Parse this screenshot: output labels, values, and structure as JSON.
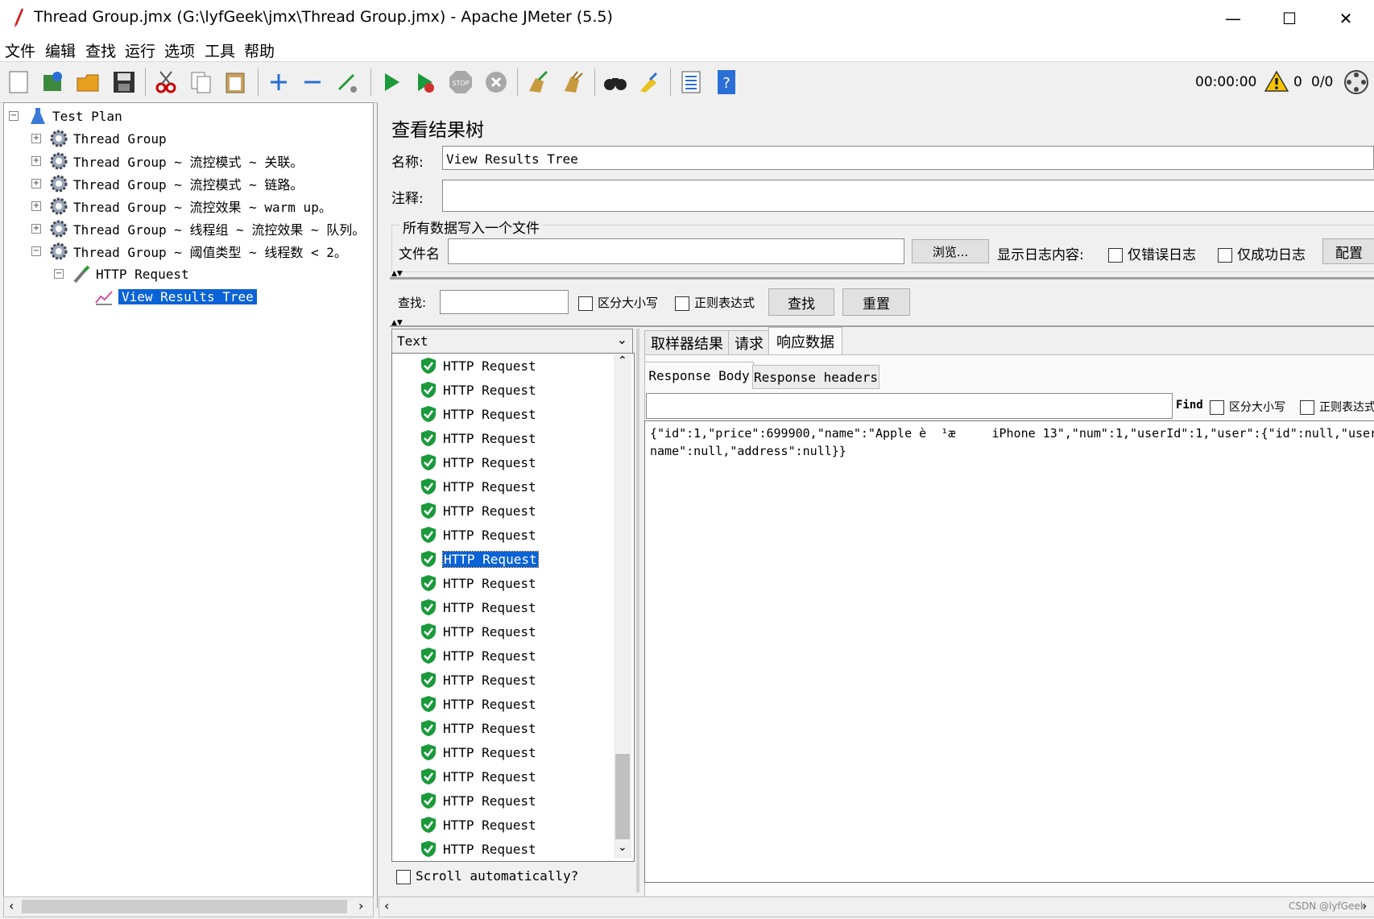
{
  "window": {
    "title": "Thread Group.jmx (G:\\lyfGeek\\jmx\\Thread Group.jmx) - Apache JMeter (5.5)",
    "minimize": "—",
    "maximize": "☐",
    "close": "✕"
  },
  "menu": [
    "文件",
    "编辑",
    "查找",
    "运行",
    "选项",
    "工具",
    "帮助"
  ],
  "toolbar": {
    "elapsed_time": "00:00:00",
    "warning_count": "0",
    "thread_count": "0/0",
    "colors": {
      "start": "#1a9a3a",
      "stop": "#9a9a9a",
      "help": "#2a6fd6"
    }
  },
  "tree": {
    "root": "Test Plan",
    "groups": [
      "Thread Group",
      "Thread Group ~ 流控模式 ~ 关联。",
      "Thread Group ~ 流控模式 ~ 链路。",
      "Thread Group ~ 流控效果 ~ warm up。",
      "Thread Group ~ 线程组 ~ 流控效果 ~ 队列。",
      "Thread Group ~ 阈值类型 ~ 线程数 < 2。"
    ],
    "sampler": "HTTP Request",
    "listener": "View Results Tree"
  },
  "panel": {
    "heading": "查看结果树",
    "name_label": "名称:",
    "name_value": "View Results Tree",
    "comment_label": "注释:",
    "comment_value": "",
    "file_section": "所有数据写入一个文件",
    "filename_label": "文件名",
    "filename_value": "",
    "browse": "浏览...",
    "log_label": "显示日志内容:",
    "errors_only": "仅错误日志",
    "success_only": "仅成功日志",
    "configure": "配置"
  },
  "search": {
    "label": "查找:",
    "value": "",
    "case": "区分大小写",
    "regex": "正则表达式",
    "find_btn": "查找",
    "reset_btn": "重置"
  },
  "results": {
    "renderer": "Text",
    "item_label": "HTTP Request",
    "item_count": 21,
    "selected_index": 8,
    "scroll_auto": "Scroll automatically?"
  },
  "detail": {
    "tabs": [
      "取样器结果",
      "请求",
      "响应数据"
    ],
    "subtabs": [
      "Response Body",
      "Response headers"
    ],
    "find_label": "Find",
    "find_value": "",
    "case": "区分大小写",
    "regex": "正则表达式",
    "body_line1": "{\"id\":1,\"price\":699900,\"name\":\"Apple è  ¹æ     iPhone 13\",\"num\":1,\"userId\":1,\"user\":{\"id\":null,\"user",
    "body_line2": "name\":null,\"address\":null}}"
  },
  "watermark": "CSDN @lyfGeek"
}
